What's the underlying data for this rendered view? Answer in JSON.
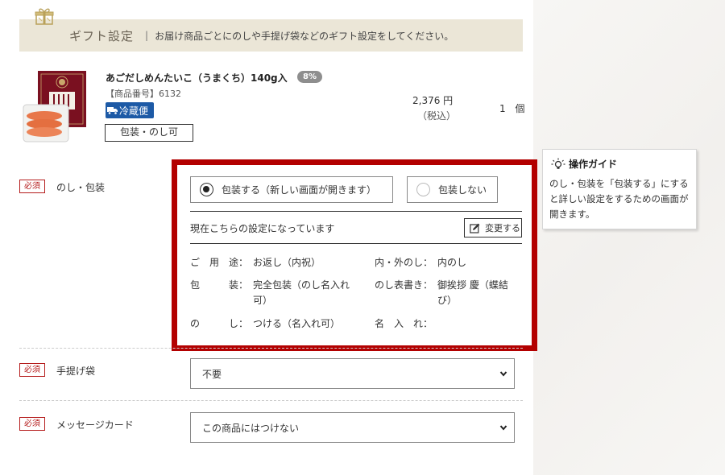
{
  "gift_settings": {
    "title": "ギフト設定",
    "separator": "|",
    "description": "お届け商品ごとにのしや手提げ袋などのギフト設定をしてください。"
  },
  "product": {
    "name": "あごだしめんたいこ（うまくち）140g入",
    "tax_rate_badge": "8%",
    "product_number": "【商品番号】6132",
    "delivery_badge": "冷蔵便",
    "wrapping_label": "包装・のし可",
    "price": "2,376 円",
    "price_tax_note": "（税込）",
    "quantity": "1 個"
  },
  "required_label": "必須",
  "noshi": {
    "label": "のし・包装",
    "option_wrap": "包装する（新しい画面が開きます）",
    "option_no_wrap": "包装しない",
    "selected": "option_wrap",
    "current_setting_text": "現在こちらの設定になっています",
    "change_button": "変更する",
    "details": {
      "use_label": "ご　用　途：",
      "use_value": "お返し（内祝）",
      "wrap_label": "包　　　装：",
      "wrap_value_1": "完全包装（のし名入れ",
      "wrap_value_2": "可）",
      "noshi_label": "の　　　し：",
      "noshi_value": "つける（名入れ可）",
      "inner_outer_label": "内・外のし：",
      "inner_outer_value": "内のし",
      "inscription_label": "のし表書き：",
      "inscription_value_1": "御挨拶 慶（蝶結",
      "inscription_value_2": "び）",
      "name_label": "名　入　れ：",
      "name_value": ""
    }
  },
  "shopping_bag": {
    "label": "手提げ袋",
    "selected": "不要"
  },
  "message_card": {
    "label": "メッセージカード",
    "selected": "この商品にはつけない"
  },
  "guide": {
    "title": "操作ガイド",
    "text": "のし・包装を「包装する」にすると詳しい設定をするための画面が開きます。"
  },
  "colors": {
    "highlight_border": "#b30000",
    "required": "#b51c1c",
    "cold_badge": "#1d5aa6",
    "gift_bar": "#ebe6d7"
  }
}
